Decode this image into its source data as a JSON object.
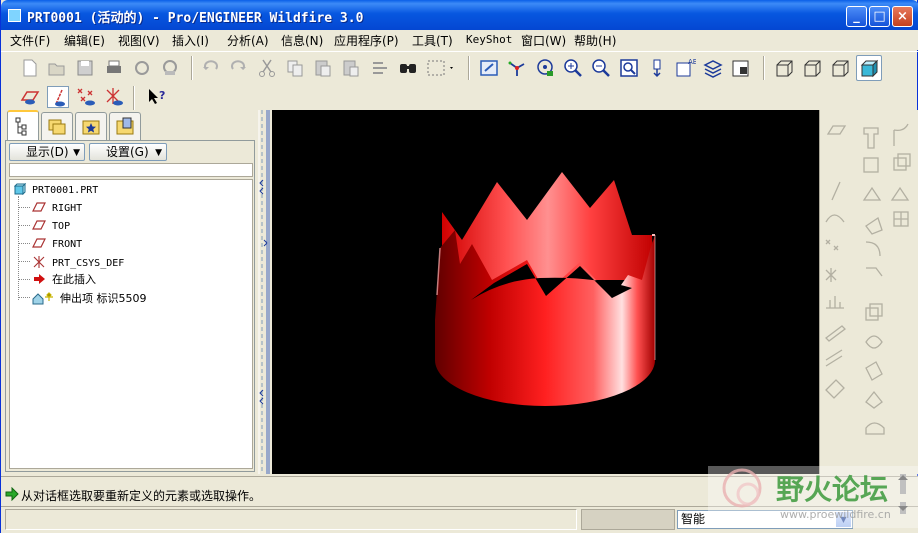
{
  "window": {
    "title": "PRT0001 (活动的) - Pro/ENGINEER Wildfire 3.0"
  },
  "title_buttons": {
    "minimize": "_",
    "maximize": "□",
    "close": "×"
  },
  "menu": [
    "文件(F)",
    "编辑(E)",
    "视图(V)",
    "插入(I)",
    "分析(A)",
    "信息(N)",
    "应用程序(P)",
    "工具(T)",
    "KeyShot",
    "窗口(W)",
    "帮助(H)"
  ],
  "toolbar": {
    "icons": [
      "new-icon",
      "open-icon",
      "save-icon",
      "print-icon",
      "send-icon",
      "email-icon",
      "undo-icon",
      "redo-icon",
      "cut-icon",
      "copy-icon",
      "paste-icon",
      "paste-special-icon",
      "regenerate-icon",
      "find-icon",
      "select-box-icon",
      "repaint-icon",
      "spin-center-icon",
      "orient-icon",
      "zoom-in-icon",
      "zoom-out-icon",
      "refit-icon",
      "reorient-icon",
      "view-list-icon",
      "layers-icon",
      "view-manager-icon",
      "wireframe-icon",
      "hidden-line-icon",
      "no-hidden-icon",
      "shading-icon"
    ]
  },
  "datum_toolbar": {
    "icons": [
      "datum-plane-display-icon",
      "datum-axis-display-icon",
      "datum-point-display-icon",
      "csys-display-icon",
      "context-help-icon"
    ]
  },
  "nav_tabs": [
    "model-tree-tab",
    "folder-browser-tab",
    "favorites-tab",
    "connections-tab"
  ],
  "panel": {
    "show_label": "显示(D)",
    "settings_label": "设置(G)"
  },
  "model_tree": [
    {
      "label": "PRT0001.PRT",
      "icon": "part-icon"
    },
    {
      "label": "RIGHT",
      "icon": "datum-plane-icon"
    },
    {
      "label": "TOP",
      "icon": "datum-plane-icon"
    },
    {
      "label": "FRONT",
      "icon": "datum-plane-icon"
    },
    {
      "label": "PRT_CSYS_DEF",
      "icon": "csys-icon"
    },
    {
      "label": "在此插入",
      "icon": "insert-here-arrow-icon"
    },
    {
      "label": "伸出项 标识5509",
      "icon": "protrusion-icon"
    }
  ],
  "right_toolbar": {
    "icons": [
      "datum-plane-tool-icon",
      "datum-axis-tool-icon",
      "datum-curve-tool-icon",
      "datum-point-tool-icon",
      "csys-tool-icon",
      "analysis-tool-icon",
      "sketch-tool-icon",
      "extrude-icon",
      "revolve-icon",
      "sweep-icon",
      "blend-icon",
      "hole-icon",
      "shell-icon",
      "rib-icon",
      "draft-icon",
      "round-icon",
      "chamfer-icon",
      "pattern-icon",
      "mirror-icon",
      "merge-icon",
      "trim-icon",
      "offset-icon",
      "thicken-icon",
      "solidify-icon"
    ]
  },
  "viewport": {
    "model": "red crown extrusion",
    "background": "#000000",
    "model_color": "#ff1a1a"
  },
  "message": {
    "text": "从对话框选取要重新定义的元素或选取操作。",
    "icon": "message-arrow-icon"
  },
  "status": {
    "selection_filter": "智能"
  },
  "watermark": {
    "text": "野火论坛",
    "url": "www.proewildfire.cn"
  },
  "colors": {
    "titlebar": "#0a5fe8",
    "chrome": "#ece9d8",
    "watermark": "#3c9a3c"
  }
}
